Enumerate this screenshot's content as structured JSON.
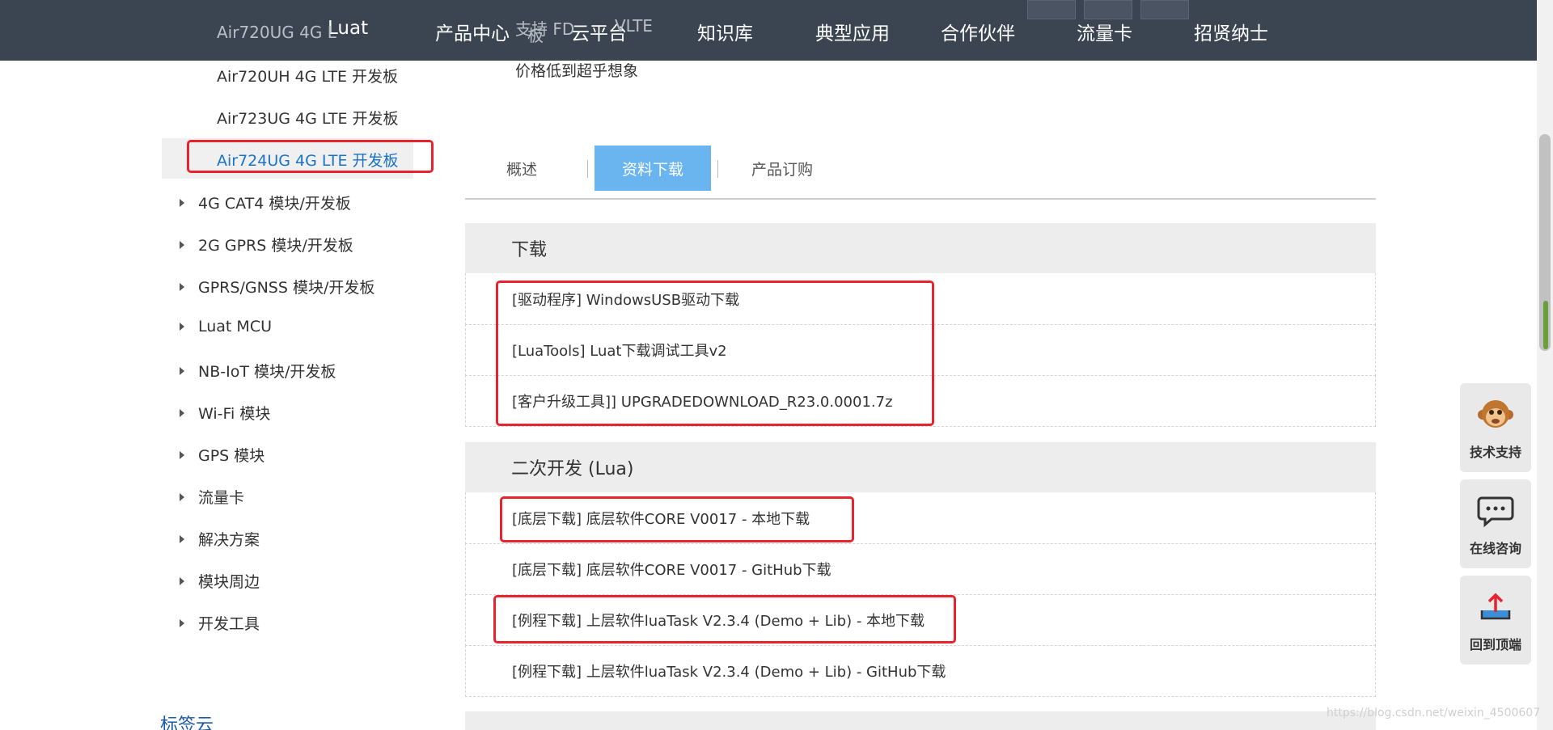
{
  "nav": {
    "logo": "Luat",
    "items": [
      "产品中心",
      "云平台",
      "知识库",
      "典型应用",
      "合作伙伴",
      "流量卡",
      "招贤纳士"
    ]
  },
  "ghost": {
    "sidebar_partial": "Air720UG 4G L",
    "sidebar_partial_end": "板",
    "main_partial": "支持 FD",
    "main_partial_end": "VLTE"
  },
  "sidebar": {
    "sub_items": [
      "Air720UH 4G LTE 开发板",
      "Air723UG 4G LTE 开发板",
      "Air724UG 4G LTE 开发板"
    ],
    "categories": [
      "4G CAT4 模块/开发板",
      "2G GPRS 模块/开发板",
      "GPRS/GNSS 模块/开发板",
      "Luat MCU",
      "NB-IoT 模块/开发板",
      "Wi-Fi 模块",
      "GPS 模块",
      "流量卡",
      "解决方案",
      "模块周边",
      "开发工具"
    ],
    "tag_cloud": "标签云"
  },
  "main": {
    "price_line": "价格低到超乎想象",
    "tabs": [
      "概述",
      "资料下载",
      "产品订购"
    ],
    "sections": [
      {
        "title": "下载",
        "items": [
          "[驱动程序] WindowsUSB驱动下载",
          "[LuaTools] Luat下载调试工具v2",
          "[客户升级工具]] UPGRADEDOWNLOAD_R23.0.0001.7z"
        ]
      },
      {
        "title": "二次开发 (Lua)",
        "items": [
          "[底层下载] 底层软件CORE V0017 - 本地下载",
          "[底层下载] 底层软件CORE V0017 - GitHub下载",
          "[例程下载] 上层软件luaTask V2.3.4 (Demo + Lib) - 本地下载",
          "[例程下载] 上层软件luaTask V2.3.4 (Demo + Lib) - GitHub下载"
        ]
      }
    ]
  },
  "float_buttons": [
    {
      "label": "技术支持",
      "icon": "monkey-icon"
    },
    {
      "label": "在线咨询",
      "icon": "chat-bubble-icon"
    },
    {
      "label": "回到顶端",
      "icon": "upload-tray-icon"
    }
  ],
  "watermark": "https://blog.csdn.net/weixin_4500607",
  "colors": {
    "nav_bg": "#3b4552",
    "active_tab": "#6ab4f0",
    "active_link": "#1a73c8",
    "highlight_box": "#e8232d"
  }
}
